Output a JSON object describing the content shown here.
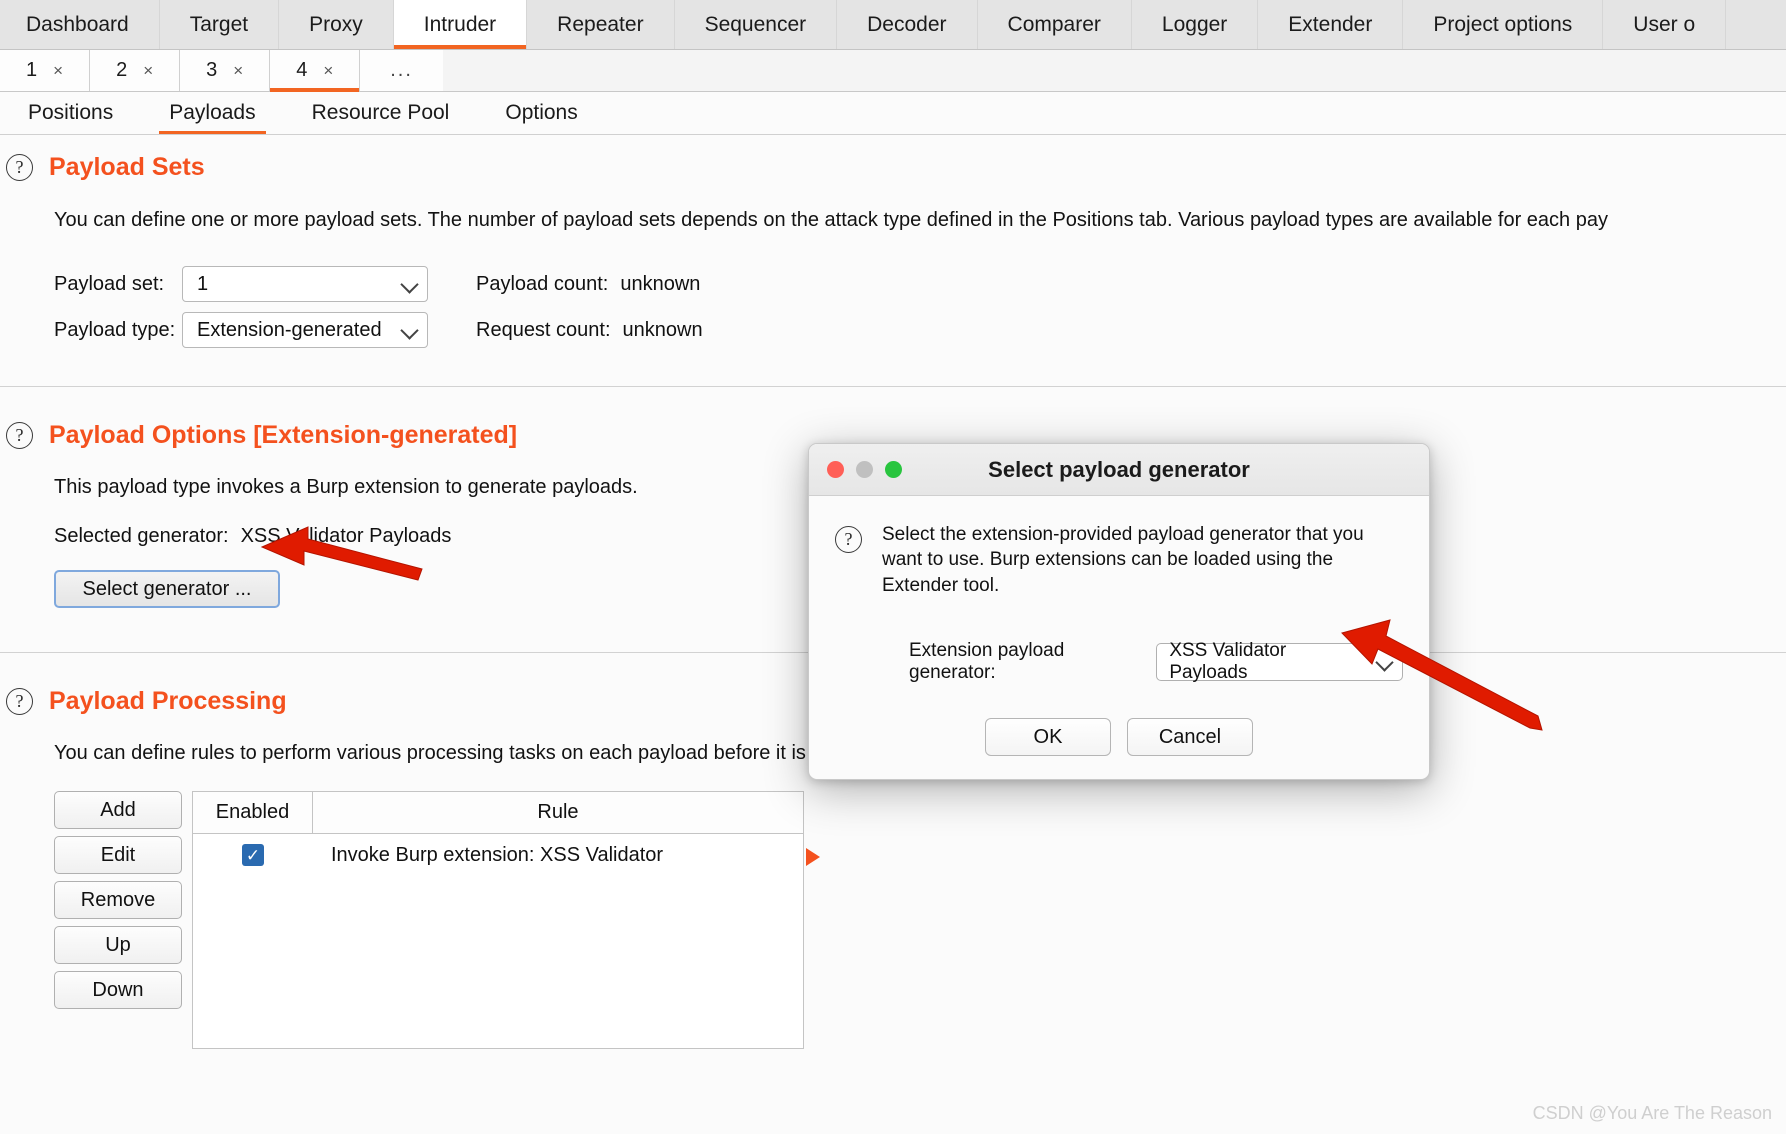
{
  "top_tabs": [
    {
      "label": "Dashboard",
      "active": false
    },
    {
      "label": "Target",
      "active": false
    },
    {
      "label": "Proxy",
      "active": false
    },
    {
      "label": "Intruder",
      "active": true
    },
    {
      "label": "Repeater",
      "active": false
    },
    {
      "label": "Sequencer",
      "active": false
    },
    {
      "label": "Decoder",
      "active": false
    },
    {
      "label": "Comparer",
      "active": false
    },
    {
      "label": "Logger",
      "active": false
    },
    {
      "label": "Extender",
      "active": false
    },
    {
      "label": "Project options",
      "active": false
    },
    {
      "label": "User o",
      "active": false
    }
  ],
  "attack_tabs": [
    {
      "label": "1",
      "close": "×",
      "active": false
    },
    {
      "label": "2",
      "close": "×",
      "active": false
    },
    {
      "label": "3",
      "close": "×",
      "active": false
    },
    {
      "label": "4",
      "close": "×",
      "active": true
    }
  ],
  "attack_tabs_more": "...",
  "sub_tabs": [
    {
      "label": "Positions",
      "active": false
    },
    {
      "label": "Payloads",
      "active": true
    },
    {
      "label": "Resource Pool",
      "active": false
    },
    {
      "label": "Options",
      "active": false
    }
  ],
  "payload_sets": {
    "help_icon": "question-icon",
    "title": "Payload Sets",
    "description": "You can define one or more payload sets. The number of payload sets depends on the attack type defined in the Positions tab. Various payload types are available for each pay",
    "payload_set_label": "Payload set:",
    "payload_set_value": "1",
    "payload_type_label": "Payload type:",
    "payload_type_value": "Extension-generated",
    "payload_count_label": "Payload count:",
    "payload_count_value": "unknown",
    "request_count_label": "Request count:",
    "request_count_value": "unknown"
  },
  "payload_options": {
    "help_icon": "question-icon",
    "title": "Payload Options [Extension-generated]",
    "description": "This payload type invokes a Burp extension to generate payloads.",
    "selected_generator_label": "Selected generator:",
    "selected_generator_value": "XSS Validator Payloads",
    "select_generator_button": "Select generator ..."
  },
  "payload_processing": {
    "help_icon": "question-icon",
    "title": "Payload Processing",
    "description": "You can define rules to perform various processing tasks on each payload before it is u",
    "buttons": [
      "Add",
      "Edit",
      "Remove",
      "Up",
      "Down"
    ],
    "columns": [
      "Enabled",
      "Rule"
    ],
    "rows": [
      {
        "enabled": true,
        "check_glyph": "✓",
        "rule": "Invoke Burp extension: XSS Validator"
      }
    ]
  },
  "dialog": {
    "title": "Select payload generator",
    "traffic_lights": [
      "close-red",
      "minimize-gray",
      "zoom-green"
    ],
    "help_icon": "question-icon",
    "description": "Select the extension-provided payload generator that you want to use. Burp extensions can be loaded using the Extender tool.",
    "field_label": "Extension payload generator:",
    "field_value": "XSS Validator Payloads",
    "ok_button": "OK",
    "cancel_button": "Cancel"
  },
  "annotations": {
    "arrow_color": "#e01b00",
    "marker_color": "#f4511e"
  },
  "watermark": "CSDN @You Are The Reason"
}
